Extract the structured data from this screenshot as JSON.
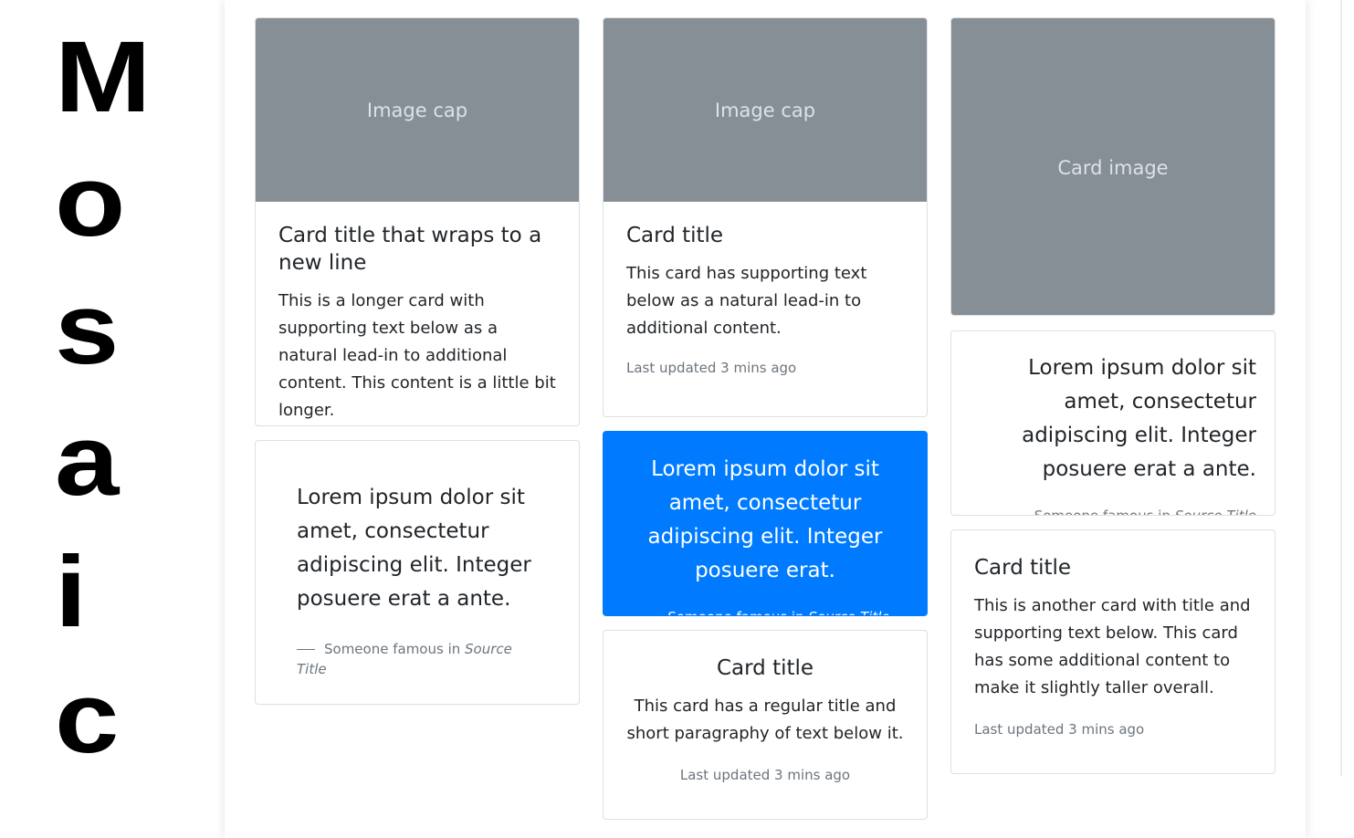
{
  "logo": {
    "letters": [
      "M",
      "o",
      "s",
      "a",
      "i",
      "c"
    ]
  },
  "cards": {
    "c1": {
      "image_caption": "Image cap",
      "title": "Card title that wraps to a new line",
      "text": "This is a longer card with supporting text below as a natural lead-in to additional content. This content is a little bit longer."
    },
    "c2": {
      "quote": "Lorem ipsum dolor sit amet, consectetur adipiscing elit. Integer posuere erat a ante.",
      "footer_prefix": "Someone famous in",
      "footer_source": "Source Title"
    },
    "c3": {
      "image_caption": "Image cap",
      "title": "Card title",
      "text": "This card has supporting text below as a natural lead-in to additional content.",
      "updated": "Last updated 3 mins ago"
    },
    "c4": {
      "quote": "Lorem ipsum dolor sit amet, consectetur adipiscing elit. Integer posuere erat.",
      "footer_prefix": "Someone famous in",
      "footer_source": "Source Title",
      "bg_color": "#007bff"
    },
    "c5": {
      "title": "Card title",
      "text": "This card has a regular title and short paragraphy of text below it.",
      "updated": "Last updated 3 mins ago"
    },
    "c6": {
      "image_caption": "Card image"
    },
    "c7": {
      "quote": "Lorem ipsum dolor sit amet, consectetur adipiscing elit. Integer posuere erat a ante.",
      "footer_prefix": "Someone famous in",
      "footer_source": "Source Title"
    },
    "c8": {
      "title": "Card title",
      "text": "This is another card with title and supporting text below. This card has some additional content to make it slightly taller overall.",
      "updated": "Last updated 3 mins ago"
    }
  },
  "colors": {
    "image_placeholder": "#868e96",
    "primary": "#007bff",
    "muted_text": "#6c757d"
  }
}
